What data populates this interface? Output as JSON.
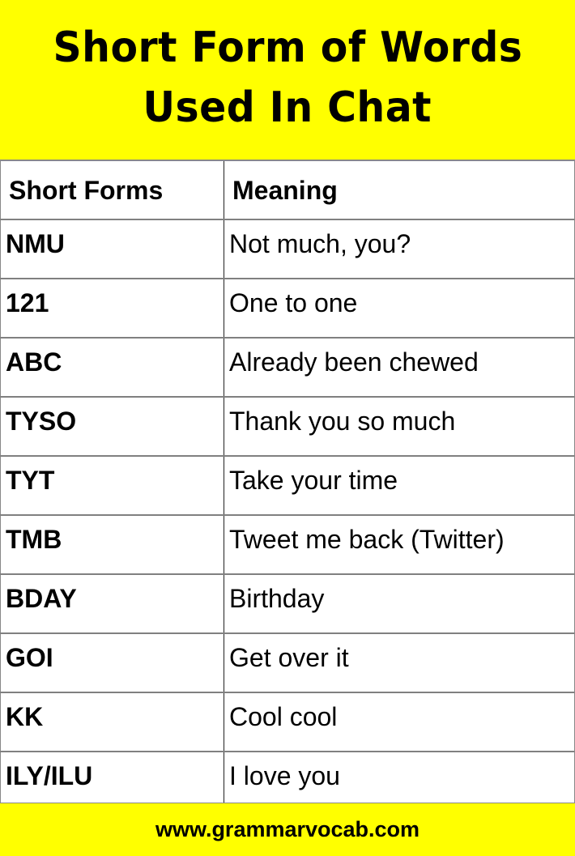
{
  "title": {
    "line1": "Short Form of Words",
    "line2": "Used In Chat"
  },
  "colors": {
    "banner_bg": "#ffff00",
    "text": "#000000",
    "grid": "#808080"
  },
  "table": {
    "headers": [
      "Short Forms",
      "Meaning"
    ],
    "rows": [
      {
        "short": "NMU",
        "meaning": "Not much, you?"
      },
      {
        "short": "121",
        "meaning": "One to one"
      },
      {
        "short": "ABC",
        "meaning": "Already been chewed"
      },
      {
        "short": "TYSO",
        "meaning": "Thank you so much"
      },
      {
        "short": "TYT",
        "meaning": "Take your time"
      },
      {
        "short": "TMB",
        "meaning": "Tweet me back (Twitter)"
      },
      {
        "short": "BDAY",
        "meaning": "Birthday"
      },
      {
        "short": "GOI",
        "meaning": "Get over it"
      },
      {
        "short": "KK",
        "meaning": "Cool cool"
      },
      {
        "short": "ILY/ILU",
        "meaning": "I love you"
      }
    ]
  },
  "footer": {
    "url": "www.grammarvocab.com"
  }
}
